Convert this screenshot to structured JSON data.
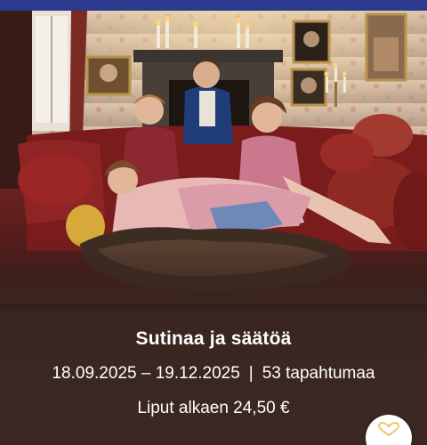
{
  "event": {
    "title": "Sutinaa ja säätöä",
    "date_range": "18.09.2025 – 19.12.2025",
    "separator": "|",
    "event_count": "53 tapahtumaa",
    "price": "Liput alkaen 24,50 €"
  },
  "image": {
    "icon": "event-photo"
  },
  "favorite": {
    "icon": "heart-outline-icon",
    "accent": "#e8c76a"
  },
  "colors": {
    "top_bar": "#2b3a8f",
    "info_background": "#3b2824",
    "text": "#ffffff"
  }
}
